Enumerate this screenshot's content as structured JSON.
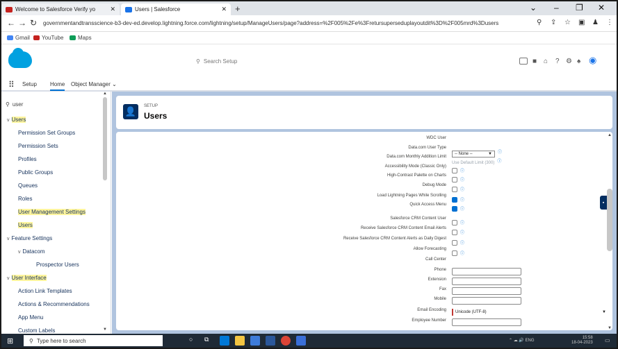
{
  "browser": {
    "tabs": [
      {
        "title": "Welcome to Salesforce Verify yo",
        "color": "#c5221f"
      },
      {
        "title": "Users | Salesforce",
        "color": "#1a73e8"
      }
    ],
    "new_tab": "+",
    "url": "governmentandtransscience-b3-dev-ed.develop.lightning.force.com/lightning/setup/ManageUsers/page?address=%2F005%2Fe%3Fretursuperseduplayoutdit%3D%2F005mrd%3Dusers",
    "bookmarks": [
      {
        "label": "Gmail",
        "color": "#4285f4"
      },
      {
        "label": "YouTube",
        "color": "#c5221f"
      },
      {
        "label": "Maps",
        "color": "#0f9d58"
      }
    ]
  },
  "salesforce": {
    "search_placeholder": "Search Setup",
    "app_name": "Setup",
    "nav": [
      "Home",
      "Object Manager"
    ],
    "quick_find_value": "user",
    "sidebar": [
      {
        "label": "Users",
        "level": 0,
        "caret": "v",
        "highlight": true
      },
      {
        "label": "Permission Set Groups",
        "level": 1,
        "highlight": false
      },
      {
        "label": "Permission Sets",
        "level": 1,
        "highlight": false
      },
      {
        "label": "Profiles",
        "level": 1,
        "highlight": false
      },
      {
        "label": "Public Groups",
        "level": 1,
        "highlight": false
      },
      {
        "label": "Queues",
        "level": 1,
        "highlight": false
      },
      {
        "label": "Roles",
        "level": 1,
        "highlight": false
      },
      {
        "label": "User Management Settings",
        "level": 1,
        "highlight": true
      },
      {
        "label": "Users",
        "level": 1,
        "highlight": true
      },
      {
        "label": "Feature Settings",
        "level": 0,
        "caret": "v",
        "highlight": false
      },
      {
        "label": "Datacom",
        "level": 1,
        "caret": "v",
        "highlight": false
      },
      {
        "label": "Prospector Users",
        "level": 2,
        "highlight": false
      },
      {
        "label": "User Interface",
        "level": 0,
        "caret": "v",
        "highlight": true
      },
      {
        "label": "Action Link Templates",
        "level": 1,
        "highlight": false
      },
      {
        "label": "Actions & Recommendations",
        "level": 1,
        "highlight": false
      },
      {
        "label": "App Menu",
        "level": 1,
        "highlight": false
      },
      {
        "label": "Custom Labels",
        "level": 1,
        "highlight": false
      }
    ],
    "header": {
      "crumb": "SETUP",
      "title": "Users"
    },
    "form": {
      "rows": [
        {
          "label": "WDC User",
          "type": "none"
        },
        {
          "label": "Data.com User Type",
          "type": "select",
          "value": "-- None --"
        },
        {
          "label": "Data.com Monthly Addition Limit",
          "type": "faded",
          "value": "Use Default Limit (300)"
        },
        {
          "label": "Accessibility Mode (Classic Only)",
          "type": "checkbox",
          "checked": false
        },
        {
          "label": "High-Contrast Palette on Charts",
          "type": "checkbox",
          "checked": false
        },
        {
          "label": "Debug Mode",
          "type": "checkbox",
          "checked": false
        },
        {
          "label": "Load Lightning Pages While Scrolling",
          "type": "checkbox",
          "checked": true
        },
        {
          "label": "Quick Access Menu",
          "type": "checkbox",
          "checked": true
        },
        {
          "label": "Salesforce CRM Content User",
          "type": "checkbox",
          "checked": false
        },
        {
          "label": "Receive Salesforce CRM Content Email Alerts",
          "type": "checkbox",
          "checked": false
        },
        {
          "label": "Receive Salesforce CRM Content Alerts as Daily Digest",
          "type": "checkbox",
          "checked": false
        },
        {
          "label": "Allow Forecasting",
          "type": "checkbox",
          "checked": false
        },
        {
          "label": "Call Center",
          "type": "none"
        },
        {
          "label": "Phone",
          "type": "text"
        },
        {
          "label": "Extension",
          "type": "text"
        },
        {
          "label": "Fax",
          "type": "text"
        },
        {
          "label": "Mobile",
          "type": "text"
        },
        {
          "label": "Email Encoding",
          "type": "required-select",
          "value": "Unicode (UTF-8)"
        },
        {
          "label": "Employee Number",
          "type": "text"
        }
      ]
    }
  },
  "taskbar": {
    "search_placeholder": "Type here to search",
    "tray_time": "15:58",
    "tray_date": "18-04-2023",
    "tray_lang": "ENG"
  },
  "colors": {
    "accent": "#0070d2",
    "brand": "#00a1e0",
    "bg_main": "#b0c4df"
  }
}
